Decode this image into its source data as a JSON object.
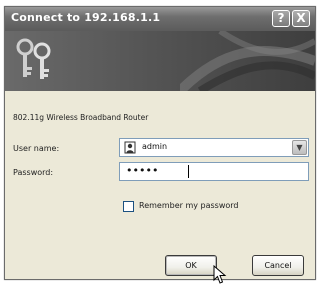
{
  "window": {
    "title": "Connect to 192.168.1.1",
    "help_label": "?",
    "close_label": "X"
  },
  "device": {
    "description": "802.11g Wireless Broadband Router"
  },
  "form": {
    "username_label": "User name:",
    "username_value": "admin",
    "password_label": "Password:",
    "password_value": "•••••",
    "remember_label": "Remember my password",
    "remember_checked": false
  },
  "buttons": {
    "ok_label": "OK",
    "cancel_label": "Cancel"
  },
  "icons": {
    "banner": "keys-icon",
    "user": "user-icon",
    "dropdown": "chevron-down-icon",
    "cursor": "mouse-pointer-icon"
  }
}
